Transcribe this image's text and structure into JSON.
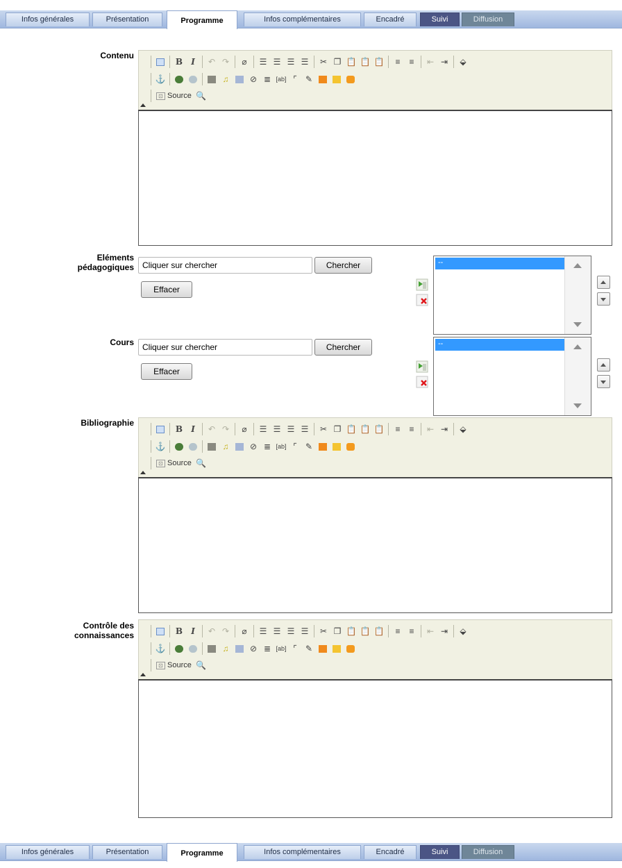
{
  "tabs": [
    {
      "label": "Infos générales",
      "state": "normal"
    },
    {
      "label": "Présentation",
      "state": "normal"
    },
    {
      "label": "Programme",
      "state": "active"
    },
    {
      "label": "Infos complémentaires",
      "state": "normal"
    },
    {
      "label": "Encadré",
      "state": "normal"
    },
    {
      "label": "Suivi",
      "state": "dark"
    },
    {
      "label": "Diffusion",
      "state": "gray"
    }
  ],
  "fields": {
    "contenu": "Contenu",
    "elements": "Eléments pédagogiques",
    "cours": "Cours",
    "bibliographie": "Bibliographie",
    "controle": "Contrôle des connaissances"
  },
  "editor": {
    "source_label": "Source",
    "icons_row1": [
      "template",
      "bold",
      "italic",
      "undo",
      "redo",
      "eraser",
      "align-left",
      "align-center",
      "align-right",
      "align-justify",
      "cut",
      "copy",
      "paste",
      "paste-text",
      "paste-word",
      "ordered-list",
      "unordered-list",
      "outdent",
      "indent",
      "box"
    ],
    "icons_row2": [
      "anchor",
      "link",
      "unlink",
      "image",
      "flash",
      "audio",
      "video",
      "special-char",
      "list-cleanup",
      "textfield",
      "checkbox",
      "drawing",
      "rss",
      "folder",
      "widget"
    ],
    "icons_row3": [
      "source",
      "preview"
    ]
  },
  "pickers": {
    "elements": {
      "placeholder": "Cliquer sur chercher",
      "search_label": "Chercher",
      "clear_label": "Effacer",
      "selected_option": "--"
    },
    "cours": {
      "placeholder": "Cliquer sur chercher",
      "search_label": "Chercher",
      "clear_label": "Effacer",
      "selected_option": "--"
    }
  },
  "colors": {
    "tab_bar": "#9fb7df",
    "tab_dark": "#4b5585",
    "tab_gray": "#6f8698",
    "list_selection": "#3399ff",
    "toolbar_bg": "#f1f1e3"
  }
}
